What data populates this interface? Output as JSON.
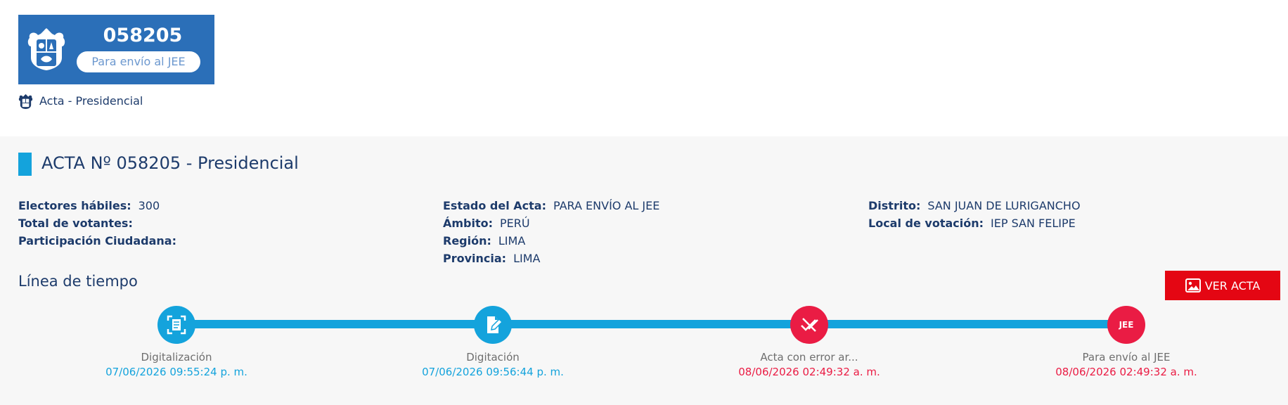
{
  "header": {
    "acta_number": "058205",
    "status_pill": "Para envío al JEE",
    "acta_type": "Acta - Presidencial"
  },
  "main": {
    "title": "ACTA Nº 058205 - Presidencial",
    "info": {
      "col1": [
        {
          "label": "Electores hábiles:",
          "value": "300"
        },
        {
          "label": "Total de votantes:",
          "value": ""
        },
        {
          "label": "Participación Ciudadana:",
          "value": ""
        }
      ],
      "col2": [
        {
          "label": "Estado del Acta:",
          "value": "PARA ENVÍO AL JEE"
        },
        {
          "label": "Ámbito:",
          "value": "PERÚ"
        },
        {
          "label": "Región:",
          "value": "LIMA"
        },
        {
          "label": "Provincia:",
          "value": "LIMA"
        }
      ],
      "col3": [
        {
          "label": "Distrito:",
          "value": "SAN JUAN DE LURIGANCHO"
        },
        {
          "label": "Local de votación:",
          "value": "IEP SAN FELIPE"
        }
      ]
    },
    "timeline_title": "Línea de tiempo",
    "ver_acta_label": "VER ACTA",
    "timeline": [
      {
        "label": "Digitalización",
        "date": "07/06/2026 09:55:24 p. m.",
        "color": "blue",
        "icon": "scan-document-icon"
      },
      {
        "label": "Digitación",
        "date": "07/06/2026 09:56:44 p. m.",
        "color": "blue",
        "icon": "edit-document-icon"
      },
      {
        "label": "Acta con error ar...",
        "date": "08/06/2026 02:49:32 a. m.",
        "color": "red",
        "icon": "error-icon"
      },
      {
        "label": "Para envío al JEE",
        "date": "08/06/2026 02:49:32 a. m.",
        "color": "red",
        "icon": "jee-icon",
        "icon_text": "JEE"
      }
    ]
  },
  "colors": {
    "primary_blue": "#2b6fb8",
    "timeline_blue": "#14a3dc",
    "alert_red": "#ea1c44",
    "button_red": "#e40613",
    "text_navy": "#1d3b6b"
  }
}
